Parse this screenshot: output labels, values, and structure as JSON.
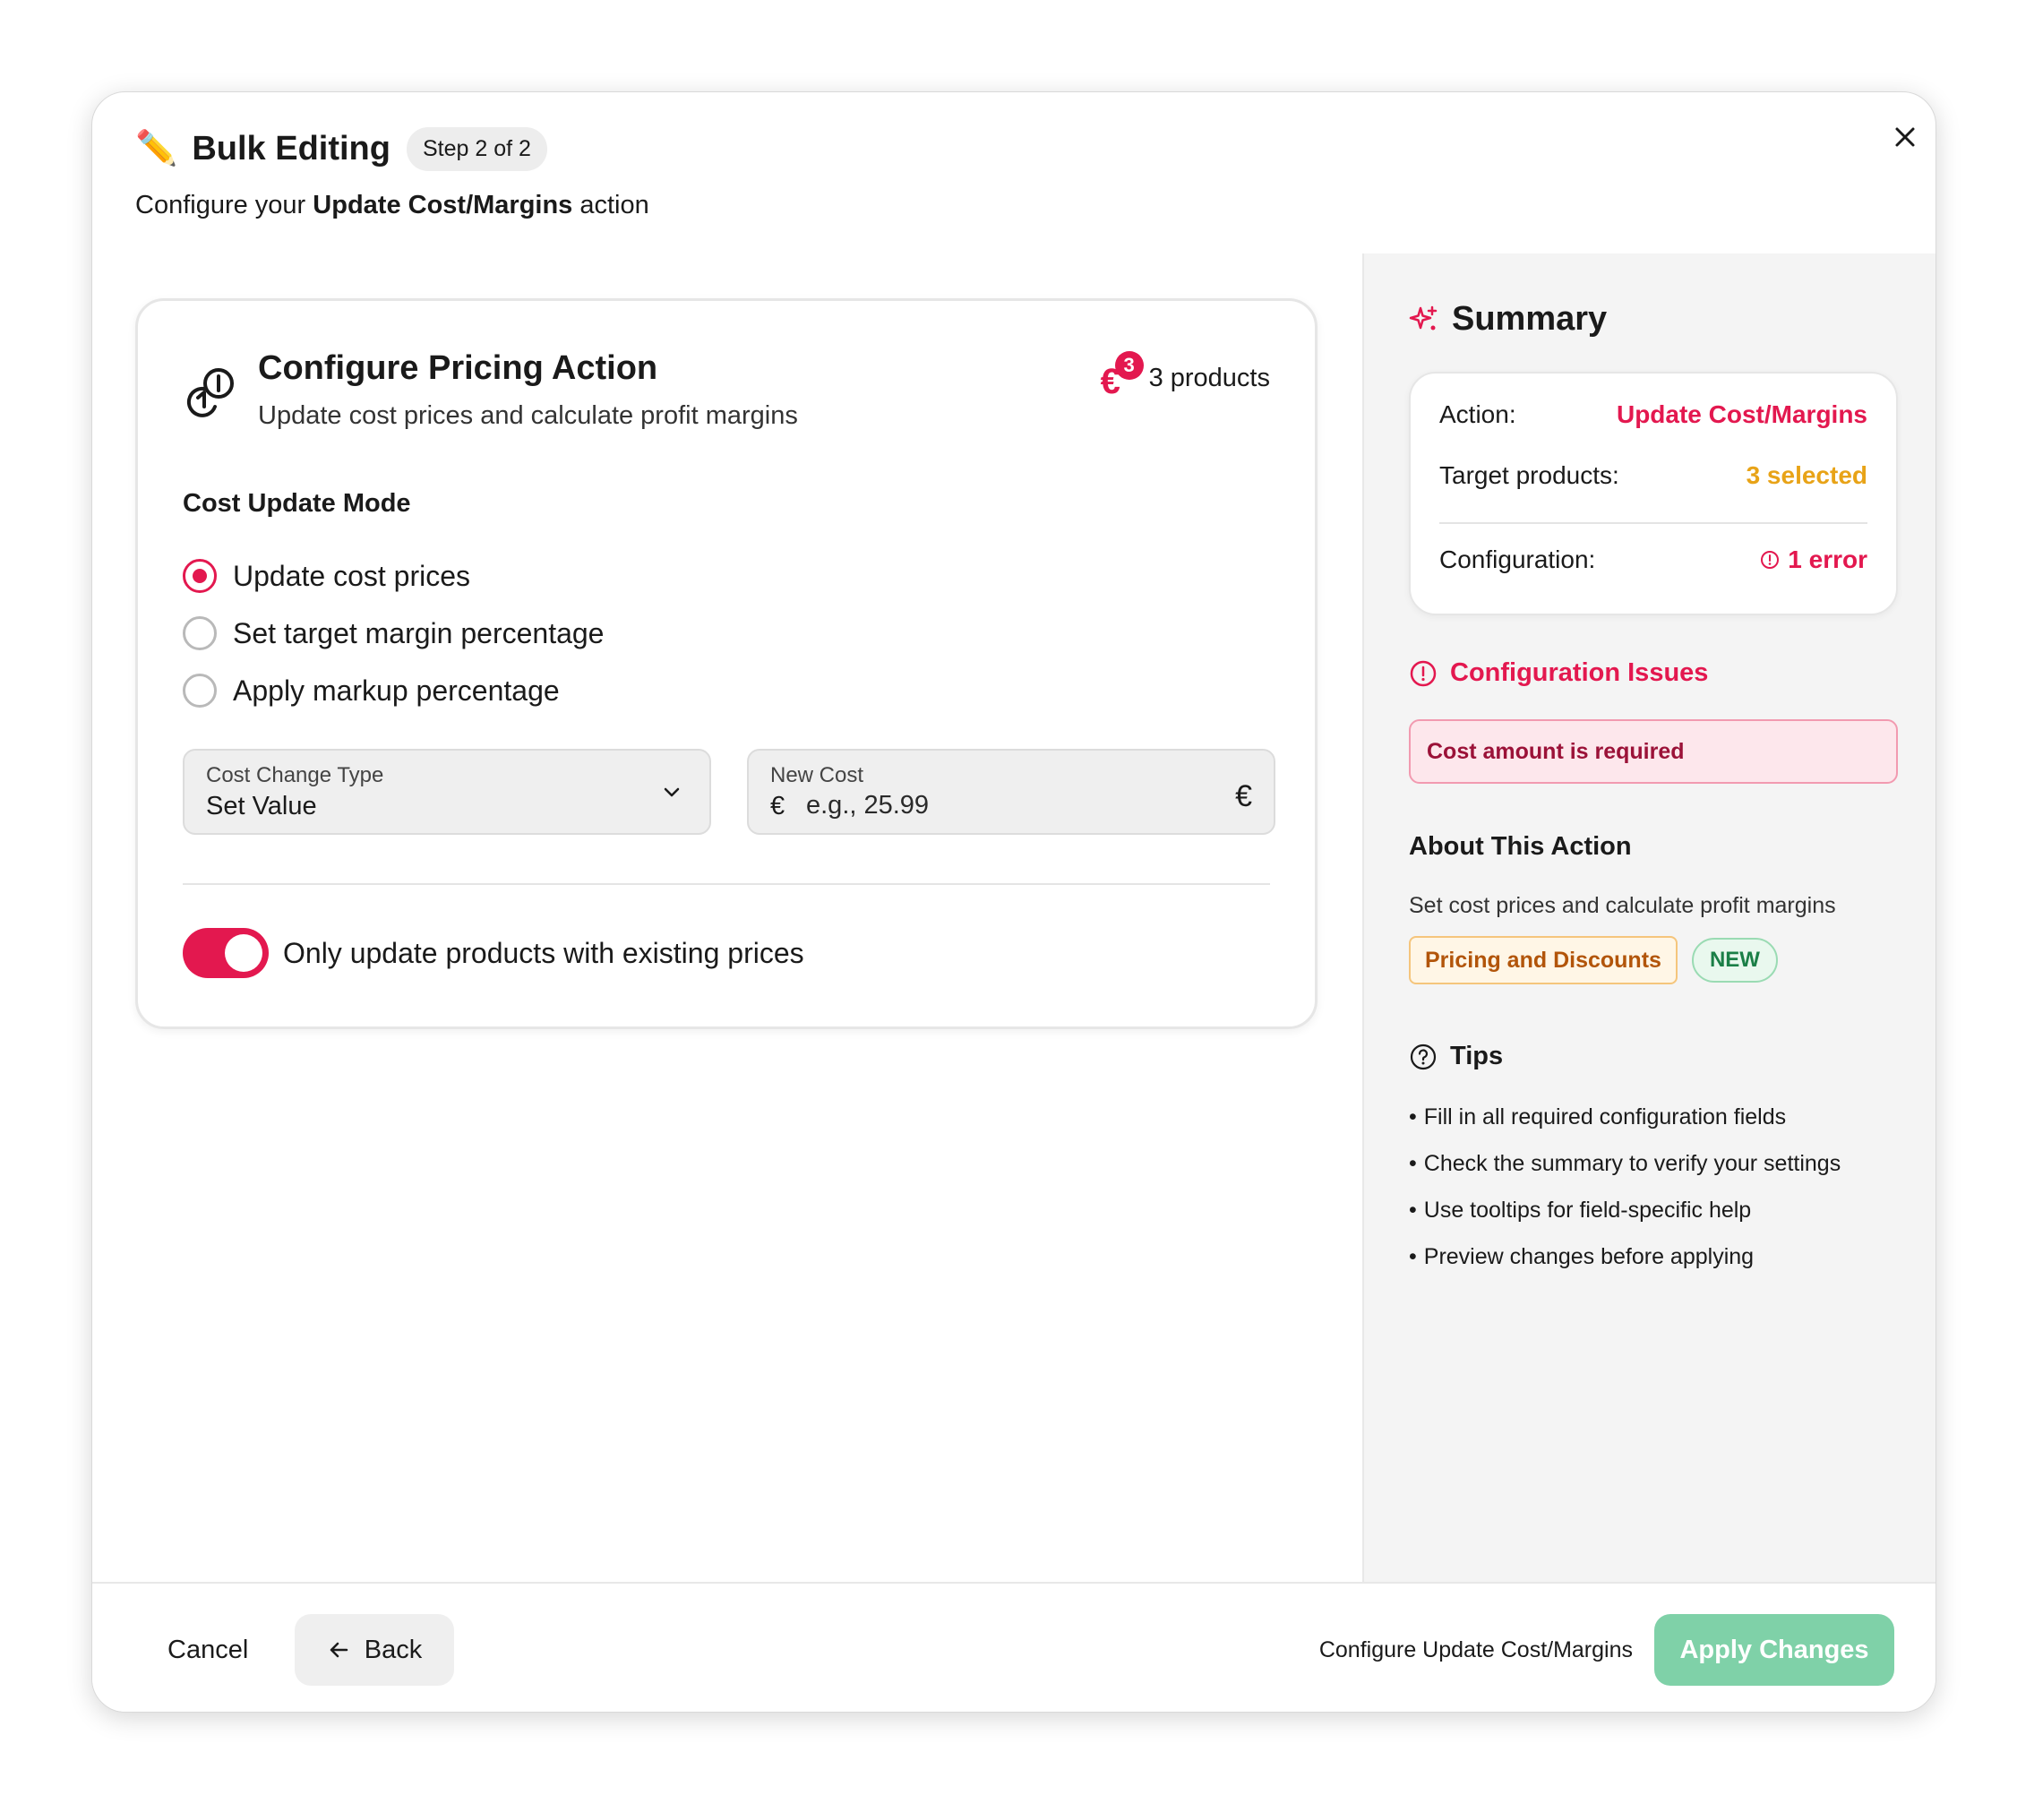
{
  "modal": {
    "title": "Bulk Editing",
    "step": "Step 2 of 2",
    "subtitle_prefix": "Configure your ",
    "subtitle_action": "Update Cost/Margins",
    "subtitle_suffix": " action",
    "close_icon": "close-icon"
  },
  "card": {
    "title": "Configure Pricing Action",
    "description": "Update cost prices and calculate profit margins",
    "products_count": "3",
    "products_label": "3 products",
    "mode_label": "Cost Update Mode",
    "radios": [
      {
        "label": "Update cost prices",
        "checked": true
      },
      {
        "label": "Set target margin percentage",
        "checked": false
      },
      {
        "label": "Apply markup percentage",
        "checked": false
      }
    ],
    "change_type": {
      "label": "Cost Change Type",
      "value": "Set Value"
    },
    "new_cost": {
      "label": "New Cost",
      "currency": "€",
      "placeholder": "e.g., 25.99",
      "suffix": "€"
    },
    "toggle": {
      "label": "Only update products with existing prices",
      "on": true
    }
  },
  "summary": {
    "title": "Summary",
    "action_label": "Action:",
    "action_value": "Update Cost/Margins",
    "target_label": "Target products:",
    "target_value": "3 selected",
    "config_label": "Configuration:",
    "config_value": "1 error",
    "issues_title": "Configuration Issues",
    "issue_message": "Cost amount is required",
    "about_title": "About This Action",
    "about_desc": "Set cost prices and calculate profit margins",
    "tag_category": "Pricing and Discounts",
    "tag_new": "NEW",
    "tips_title": "Tips",
    "tips": [
      "Fill in all required configuration fields",
      "Check the summary to verify your settings",
      "Use tooltips for field-specific help",
      "Preview changes before applying"
    ]
  },
  "footer": {
    "cancel": "Cancel",
    "back": "Back",
    "hint": "Configure Update Cost/Margins",
    "apply": "Apply Changes"
  },
  "colors": {
    "accent": "#e3184f",
    "warning": "#e8a317",
    "apply_disabled": "#7fd1a8",
    "panel_bg": "#f4f4f4"
  }
}
